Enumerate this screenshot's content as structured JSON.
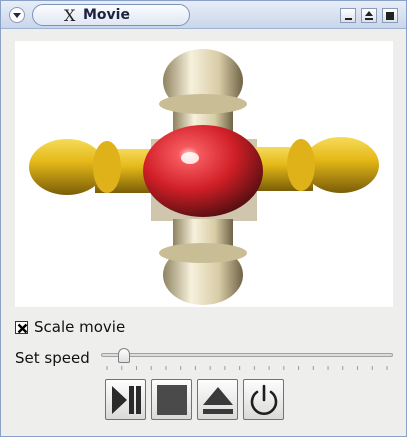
{
  "window": {
    "title": "Movie",
    "title_icon": "x-logo-icon",
    "buttons": [
      "menu",
      "minimize",
      "maximize",
      "close"
    ]
  },
  "movie": {
    "content": "animated molecule",
    "colors": {
      "center": "#d5242c",
      "arms_vertical": "#e6dcbc",
      "arms_horizontal": "#e2b81c"
    }
  },
  "options": {
    "scale_movie_label": "Scale movie",
    "scale_movie_checked": true
  },
  "speed": {
    "label": "Set speed",
    "value_fraction": 0.06,
    "tick_count": 20
  },
  "controls": [
    {
      "name": "play-pause",
      "icon": "play-pause-icon"
    },
    {
      "name": "stop",
      "icon": "stop-icon"
    },
    {
      "name": "eject",
      "icon": "eject-icon"
    },
    {
      "name": "power",
      "icon": "power-icon"
    }
  ]
}
